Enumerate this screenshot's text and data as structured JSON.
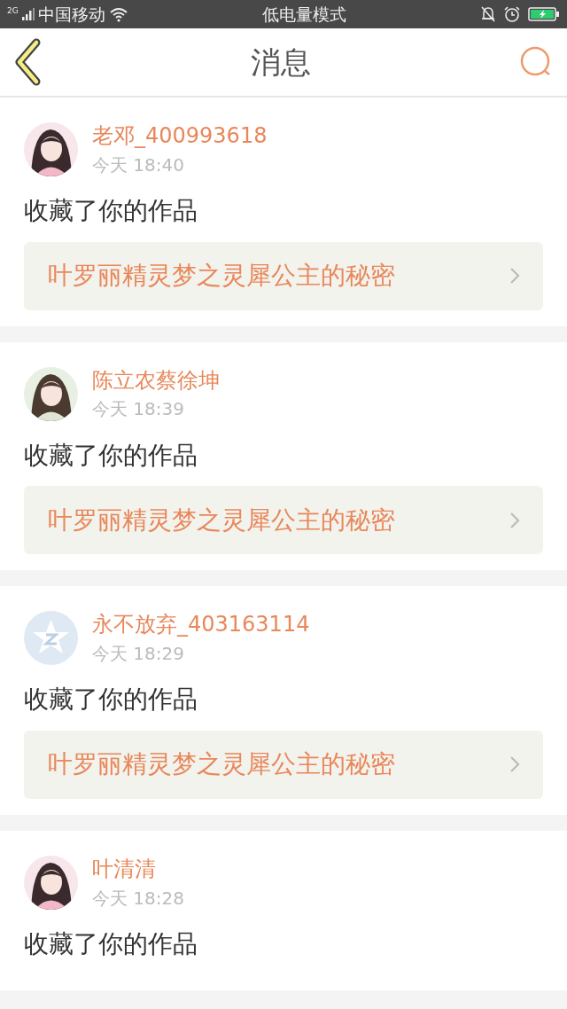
{
  "status_bar": {
    "network": "2G",
    "carrier": "中国移动",
    "mode": "低电量模式",
    "battery_charging": true
  },
  "header": {
    "title": "消息"
  },
  "messages": [
    {
      "user": "老邓_400993618",
      "time": "今天 18:40",
      "action": "收藏了你的作品",
      "work": "叶罗丽精灵梦之灵犀公主的秘密"
    },
    {
      "user": "陈立农蔡徐坤",
      "time": "今天 18:39",
      "action": "收藏了你的作品",
      "work": "叶罗丽精灵梦之灵犀公主的秘密"
    },
    {
      "avatar": {
        "kind": "default"
      },
      "user": "永不放弃_403163114",
      "time": "今天 18:29",
      "action": "收藏了你的作品",
      "work": "叶罗丽精灵梦之灵犀公主的秘密"
    },
    {
      "user": "叶清清",
      "time": "今天 18:28",
      "action": "收藏了你的作品"
    }
  ]
}
